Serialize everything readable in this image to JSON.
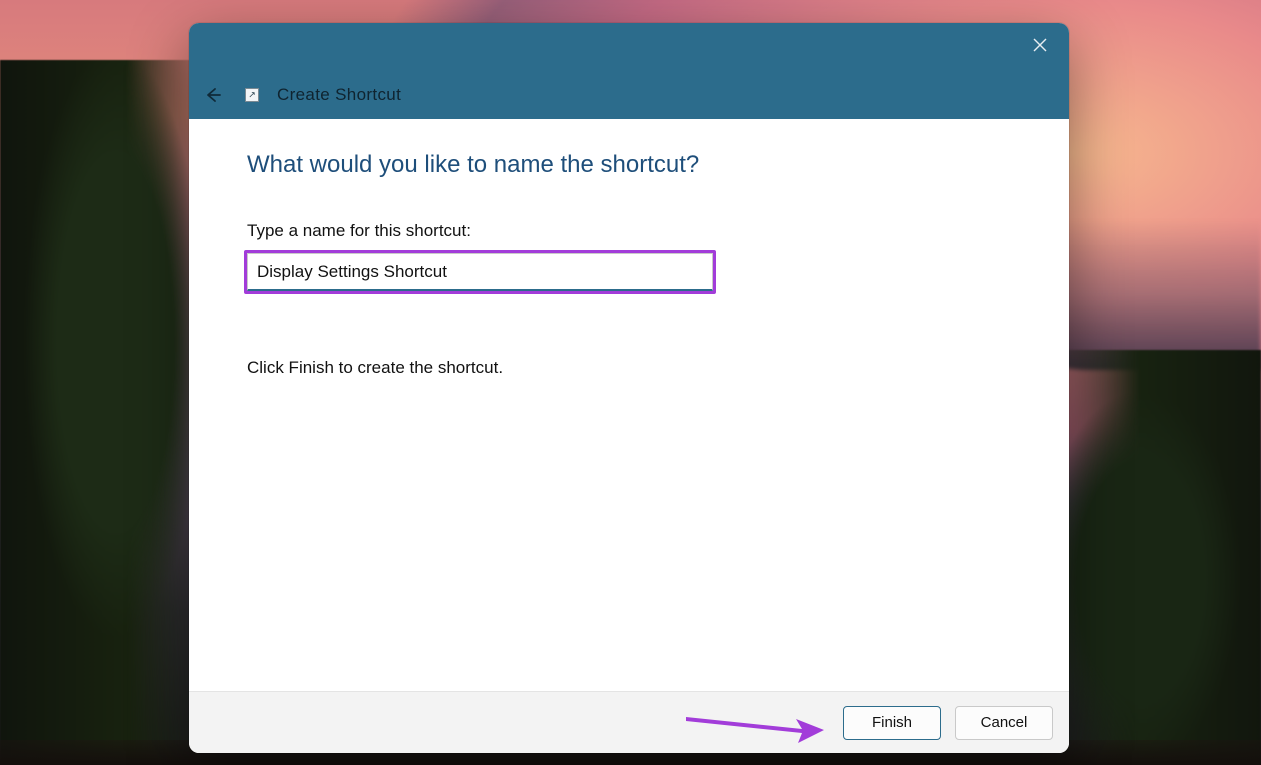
{
  "dialog": {
    "title": "Create Shortcut",
    "heading": "What would you like to name the shortcut?",
    "input_label": "Type a name for this shortcut:",
    "input_value": "Display Settings Shortcut",
    "instruction": "Click Finish to create the shortcut."
  },
  "buttons": {
    "finish": "Finish",
    "cancel": "Cancel"
  },
  "annotations": {
    "input_highlight_color": "#a23cd9",
    "arrow_color": "#a23cd9"
  }
}
